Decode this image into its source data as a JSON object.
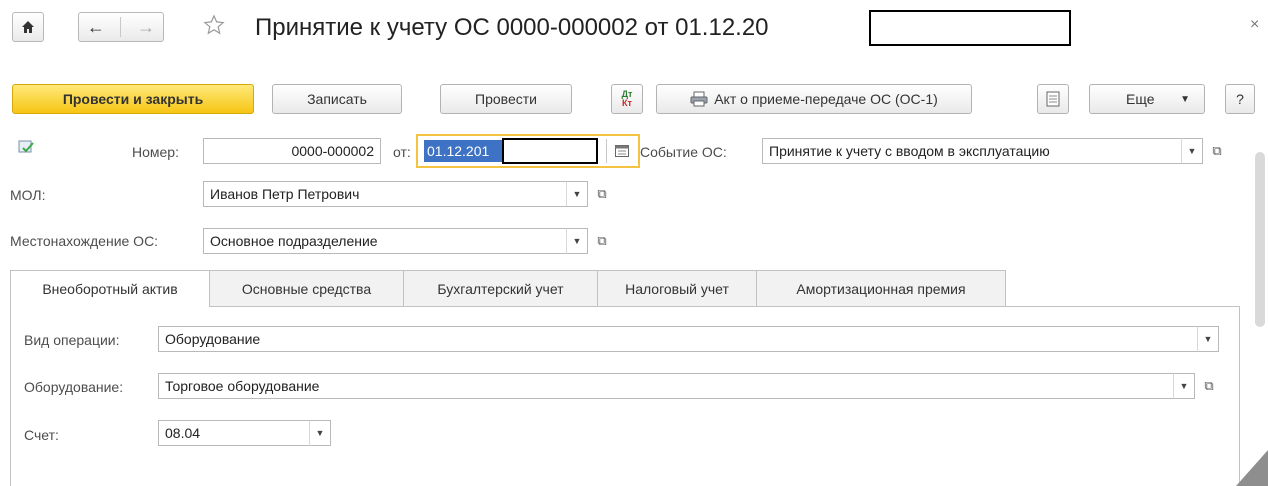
{
  "header": {
    "title": "Принятие к учету ОС 0000-000002 от 01.12.20",
    "home_icon": "home-icon",
    "back_icon": "arrow-left-icon",
    "forward_icon": "arrow-right-icon",
    "favorite_icon": "star-outline-icon",
    "close_glyph": "×"
  },
  "toolbar": {
    "post_and_close": "Провести и закрыть",
    "save": "Записать",
    "post": "Провести",
    "dtkt_icon": "dt-kt-icon",
    "act_print": "Акт о приеме-передаче ОС (ОС-1)",
    "print_icon": "printer-icon",
    "report_icon": "document-icon",
    "more": "Еще",
    "help": "?"
  },
  "form": {
    "status_icon": "posted-document-icon",
    "number_label": "Номер:",
    "number_value": "0000-000002",
    "date_label": "от:",
    "date_value": "01.12.201",
    "event_label": "Событие ОС:",
    "event_value": "Принятие к учету с вводом в эксплуатацию",
    "mol_label": "МОЛ:",
    "mol_value": "Иванов Петр Петрович",
    "location_label": "Местонахождение ОС:",
    "location_value": "Основное подразделение"
  },
  "tabs": [
    {
      "label": "Внеоборотный актив",
      "active": true
    },
    {
      "label": "Основные средства",
      "active": false
    },
    {
      "label": "Бухгалтерский учет",
      "active": false
    },
    {
      "label": "Налоговый учет",
      "active": false
    },
    {
      "label": "Амортизационная премия",
      "active": false
    }
  ],
  "tab_content": {
    "operation_label": "Вид операции:",
    "operation_value": "Оборудование",
    "equipment_label": "Оборудование:",
    "equipment_value": "Торговое оборудование",
    "account_label": "Счет:",
    "account_value": "08.04"
  },
  "colors": {
    "primary_button": "#f6c514",
    "date_focus_border": "#f5c342",
    "date_selection": "#3e72c4"
  }
}
